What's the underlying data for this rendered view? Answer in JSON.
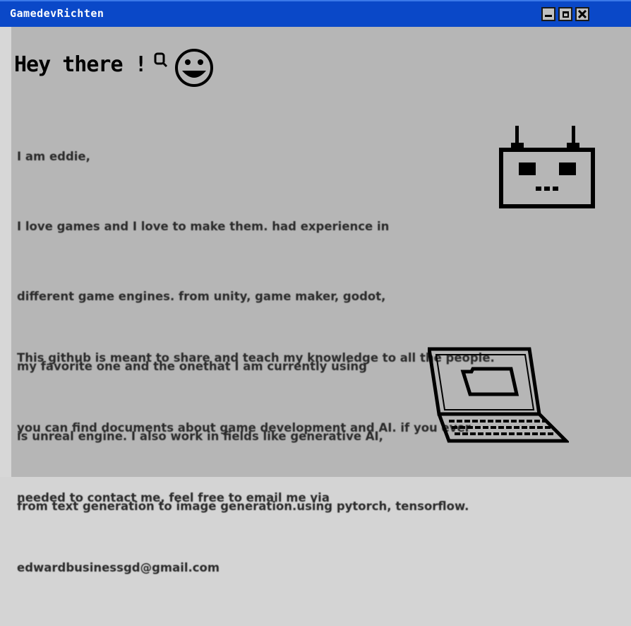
{
  "window": {
    "title": "GamedevRichten",
    "controls": {
      "minimize": "minimize",
      "maximize": "maximize",
      "close": "close"
    }
  },
  "content": {
    "heading": "Hey there !",
    "paragraph1": [
      "I am eddie,",
      "I love games and I love to make them. had experience in",
      "different game engines. from unity, game maker, godot,",
      "my favorite one and the onethat I am currently using",
      "is unreal engine. I also work in fields like generative AI,",
      "from text generation to image generation.using pytorch, tensorflow."
    ],
    "paragraph2": [
      "This github is meant to share and teach my knowledge to all the people.",
      "you can find documents about game development and AI. if you ever",
      "needed to contact me, feel free to email me via",
      "edwardbusinessgd@gmail.com"
    ]
  },
  "icons": [
    "smiley-icon",
    "robot-icon",
    "laptop-folder-icon"
  ],
  "colors": {
    "titlebar": "#0a48c8",
    "window_bg": "#b6b6b6",
    "text": "#2a2a2a"
  }
}
